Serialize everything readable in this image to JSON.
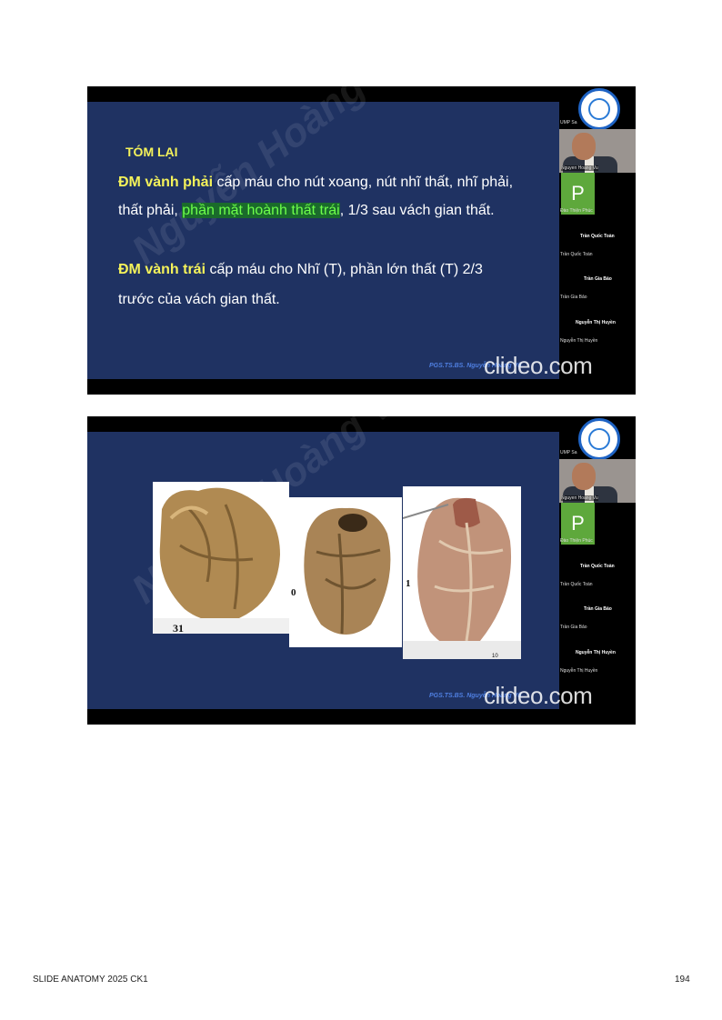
{
  "slides": [
    {
      "title": "TÓM LẠI",
      "right_label": "ĐM vành phải",
      "right_line1_rest": " cấp máu cho nút xoang, nút nhĩ thất, nhĩ phải,",
      "right_line2_pre": "thất phải, ",
      "right_line2_highlight": "phần mặt hoành thất trái",
      "right_line2_post": ", 1/3 sau vách gian thất.",
      "left_label": "ĐM vành trái",
      "left_line1_rest": " cấp máu cho Nhĩ (T), phần lớn thất (T) 2/3",
      "left_line2": "trước của vách gian thất.",
      "credit": "PGS.TS.BS. Nguyễn Hoàng Vũ",
      "clideo": "clideo.com",
      "watermark": "Nguyễn Hoàng Vũ"
    },
    {
      "credit": "PGS.TS.BS. Nguyễn Hoàng Vũ",
      "clideo": "clideo.com",
      "watermark": "Nguyễn Hoàng Vũ",
      "photo_labels": [
        "31",
        "0",
        "1",
        "10"
      ]
    }
  ],
  "participants": {
    "host_label": "UMP Sa",
    "cam_label": "Nguyen Hoang Vu",
    "p_letter": "P",
    "p_label": "Đào Thiện Phúc",
    "names": [
      "Trần Quốc Toàn",
      "Trần Gia Bảo",
      "Nguyễn Thị Huyền"
    ],
    "subs": [
      "Trần Quốc Toàn",
      "Trần Gia Bảo",
      "Nguyễn Thị Huyền"
    ]
  },
  "footer": {
    "left": "SLIDE ANATOMY 2025 CK1",
    "page": "194"
  },
  "colors": {
    "slide_blue": "#1f3262",
    "accent_yellow": "#f4f25a",
    "highlight_green": "#6dff4a"
  }
}
